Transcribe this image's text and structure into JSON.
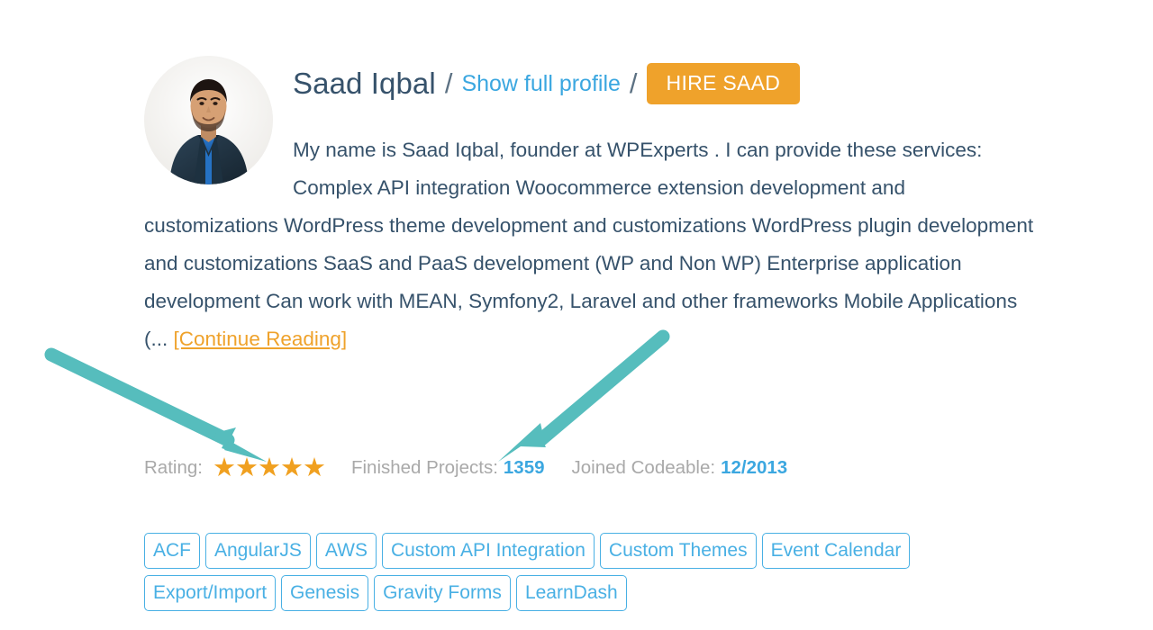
{
  "profile": {
    "avatar_alt": "Saad Iqbal profile photo",
    "name": "Saad Iqbal",
    "separator": "/",
    "show_profile_link": "Show full profile",
    "hire_button": "HIRE SAAD",
    "bio_text": "My name is Saad Iqbal, founder at WPExperts . I can provide these services: Complex API integration Woocommerce extension development and customizations WordPress theme development and customizations WordPress plugin development and customizations SaaS and PaaS development (WP and Non WP) Enterprise application development Can work with MEAN, Symfony2, Laravel and other frameworks Mobile Applications (...",
    "continue_reading": "[Continue Reading]"
  },
  "stats": {
    "rating_label": "Rating:",
    "rating_stars": 5,
    "star_glyph": "★",
    "finished_projects_label": "Finished Projects:",
    "finished_projects_value": "1359",
    "joined_label": "Joined Codeable:",
    "joined_value": "12/2013"
  },
  "tags": [
    "ACF",
    "AngularJS",
    "AWS",
    "Custom API Integration",
    "Custom Themes",
    "Event Calendar",
    "Export/Import",
    "Genesis",
    "Gravity Forms",
    "LearnDash"
  ],
  "annotations": {
    "arrow_color": "#56bdbd",
    "arrow_one_target": "rating-stars",
    "arrow_two_target": "finished-projects-value"
  },
  "colors": {
    "name": "#36526b",
    "link_blue": "#3ba7e0",
    "accent_orange": "#efa22b",
    "tag_blue": "#49b0e4",
    "muted_gray": "#a9a9a9",
    "star_orange": "#f0a020",
    "arrow_teal": "#56bdbd",
    "page_background": "#ffffff"
  }
}
